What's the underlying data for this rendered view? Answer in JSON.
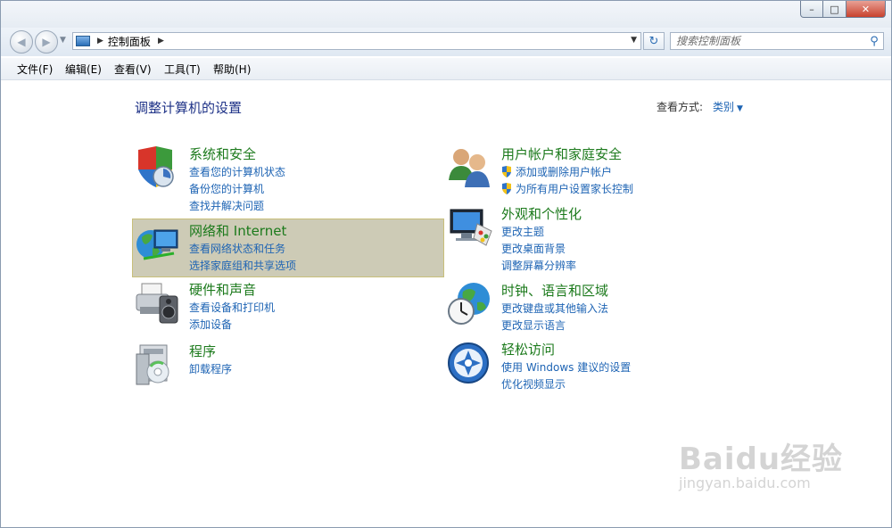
{
  "window": {
    "minimize_label": "–",
    "maximize_label": "□",
    "close_label": "✕"
  },
  "navbar": {
    "breadcrumb": "控制面板",
    "search_placeholder": "搜索控制面板"
  },
  "menubar": {
    "items": [
      "文件(F)",
      "编辑(E)",
      "查看(V)",
      "工具(T)",
      "帮助(H)"
    ]
  },
  "page": {
    "title": "调整计算机的设置",
    "view_mode_label": "查看方式:",
    "view_mode_value": "类别"
  },
  "categories": [
    {
      "icon": "shield-icon",
      "title": "系统和安全",
      "links": [
        "查看您的计算机状态",
        "备份您的计算机",
        "查找并解决问题"
      ]
    },
    {
      "icon": "network-globe-icon",
      "title": "网络和 Internet",
      "links": [
        "查看网络状态和任务",
        "选择家庭组和共享选项"
      ]
    },
    {
      "icon": "printer-icon",
      "title": "硬件和声音",
      "links": [
        "查看设备和打印机",
        "添加设备"
      ]
    },
    {
      "icon": "programs-icon",
      "title": "程序",
      "links": [
        "卸载程序"
      ]
    },
    {
      "icon": "users-icon",
      "title": "用户帐户和家庭安全",
      "links": [
        "添加或删除用户帐户",
        "为所有用户设置家长控制"
      ]
    },
    {
      "icon": "monitor-paint-icon",
      "title": "外观和个性化",
      "links": [
        "更改主题",
        "更改桌面背景",
        "调整屏幕分辨率"
      ]
    },
    {
      "icon": "clock-globe-icon",
      "title": "时钟、语言和区域",
      "links": [
        "更改键盘或其他输入法",
        "更改显示语言"
      ]
    },
    {
      "icon": "accessibility-icon",
      "title": "轻松访问",
      "links": [
        "使用 Windows 建议的设置",
        "优化视频显示"
      ]
    }
  ],
  "colors": {
    "category_title": "#1c7a1c",
    "link": "#1e64b4",
    "page_title": "#1e3287",
    "highlight_bg": "#cdcbb6"
  },
  "watermark": {
    "logo": "Baidu经验",
    "url": "jingyan.baidu.com"
  }
}
